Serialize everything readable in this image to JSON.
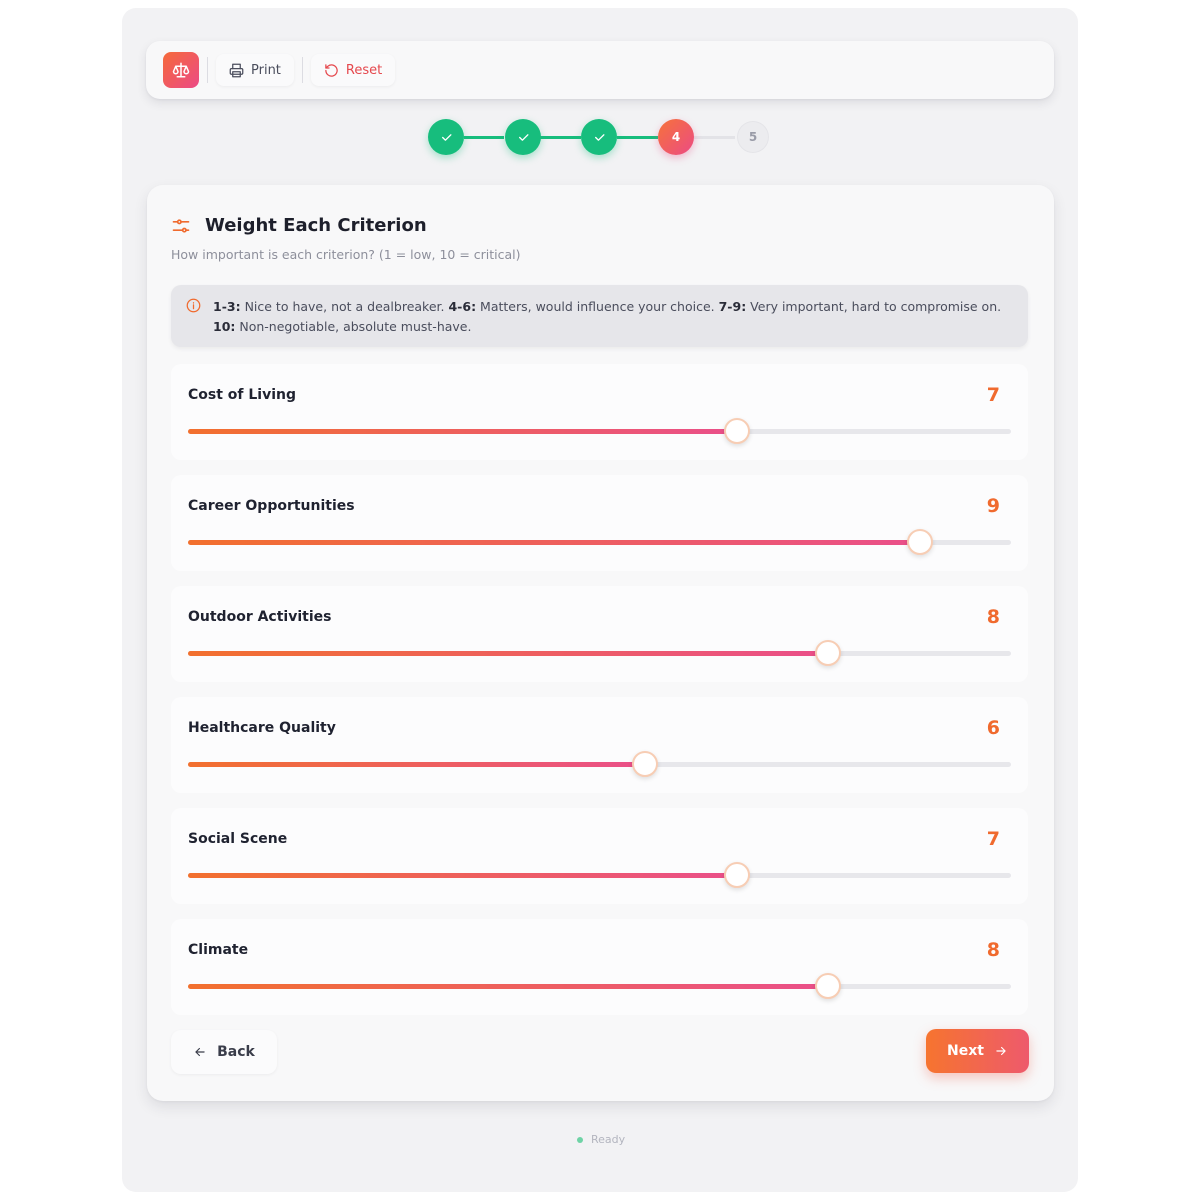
{
  "toolbar": {
    "logo_icon": "scale-icon",
    "print_label": "Print",
    "reset_label": "Reset"
  },
  "stepper": {
    "steps": [
      {
        "label": "",
        "state": "done"
      },
      {
        "label": "",
        "state": "done"
      },
      {
        "label": "",
        "state": "done"
      },
      {
        "label": "4",
        "state": "active"
      },
      {
        "label": "5",
        "state": "pending"
      }
    ]
  },
  "card": {
    "title": "Weight Each Criterion",
    "subtitle": "How important is each criterion? (1 = low, 10 = critical)",
    "info": {
      "r1_key": "1-3:",
      "r1_text": " Nice to have, not a dealbreaker. ",
      "r2_key": "4-6:",
      "r2_text": " Matters, would influence your choice. ",
      "r3_key": "7-9:",
      "r3_text": " Very important, hard to compromise on. ",
      "r4_key": "10:",
      "r4_text": " Non-negotiable, absolute must-have."
    },
    "criteria": [
      {
        "label": "Cost of Living",
        "value": "7"
      },
      {
        "label": "Career Opportunities",
        "value": "9"
      },
      {
        "label": "Outdoor Activities",
        "value": "8"
      },
      {
        "label": "Healthcare Quality",
        "value": "6"
      },
      {
        "label": "Social Scene",
        "value": "7"
      },
      {
        "label": "Climate",
        "value": "8"
      }
    ],
    "slider_range": [
      1,
      10
    ],
    "back_label": "Back",
    "next_label": "Next"
  },
  "status": {
    "text": "Ready"
  },
  "colors": {
    "accent": "#f06a2e",
    "accent_pink": "#ec4b84",
    "done_green": "#17bd7d",
    "reset_red": "#e5484d"
  }
}
